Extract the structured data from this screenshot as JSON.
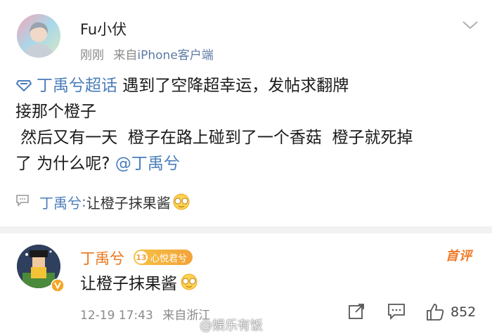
{
  "post": {
    "username": "Fu小伏",
    "time": "刚刚",
    "source_prefix": "来自",
    "source": "iPhone客户端",
    "topic": "丁禹兮超话",
    "line1_text": " 遇到了空降超幸运，发帖求翻牌",
    "line2": "接那个橙子",
    "line3": " 然后又有一天  橙子在路上碰到了一个香菇  橙子就死掉",
    "line4_text": "了 为什么呢? ",
    "mention": "@丁禹兮",
    "quote_author": "丁禹兮",
    "quote_sep": ": ",
    "quote_text": "让橙子抹果酱"
  },
  "comment": {
    "username": "丁禹兮",
    "badge_level": "13",
    "badge_text": "心悦君兮",
    "hot_tag": "首评",
    "text": "让橙子抹果酱",
    "date": "12-19 17:43",
    "location": "来自浙江",
    "like_count": "852"
  },
  "watermark": {
    "text": "@娱乐有饭"
  },
  "icons": {
    "chevron": "chevron-down-icon",
    "topic": "super-topic-icon",
    "quote": "comment-quote-icon",
    "emoji": "laughing-tears-emoji",
    "share": "share-icon",
    "comment": "comment-icon",
    "like": "thumbs-up-icon"
  },
  "colors": {
    "link": "#4a7dbb",
    "comment_name": "#e8761c",
    "meta": "#8a8a8a"
  }
}
